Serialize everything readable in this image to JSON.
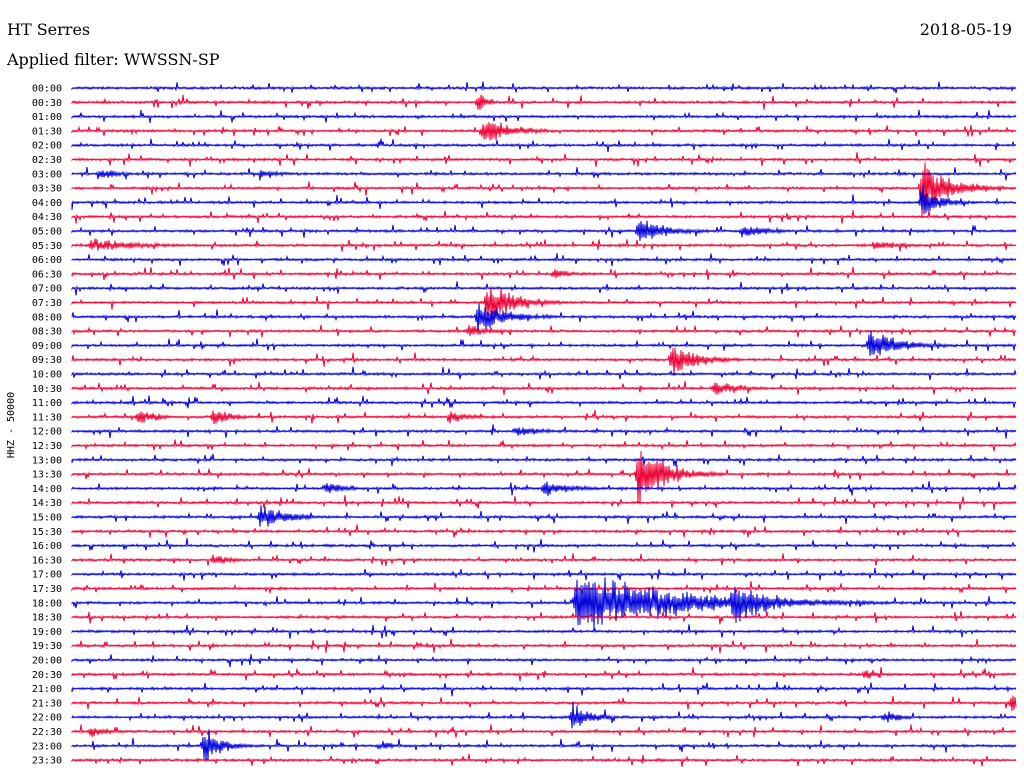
{
  "header": {
    "station": "HT Serres",
    "date": "2018-05-19",
    "filter": "Applied filter: WWSSN-SP"
  },
  "chart_data": {
    "type": "line",
    "ylabel": "HHZ - 50000",
    "tick_labels": [
      "00:00",
      "00:30",
      "01:00",
      "01:30",
      "02:00",
      "02:30",
      "03:00",
      "03:30",
      "04:00",
      "04:30",
      "05:00",
      "05:30",
      "06:00",
      "06:30",
      "07:00",
      "07:30",
      "08:00",
      "08:30",
      "09:00",
      "09:30",
      "10:00",
      "10:30",
      "11:00",
      "11:30",
      "12:00",
      "12:30",
      "13:00",
      "13:30",
      "14:00",
      "14:30",
      "15:00",
      "15:30",
      "16:00",
      "16:30",
      "17:00",
      "17:30",
      "18:00",
      "18:30",
      "19:00",
      "19:30",
      "20:00",
      "20:30",
      "21:00",
      "21:30",
      "22:00",
      "22:30",
      "23:00",
      "23:30"
    ],
    "colors": {
      "even": "#0000dd",
      "odd": "#ee0033"
    },
    "events": [
      {
        "row": 1,
        "t": 0.43,
        "amp": 0.9,
        "dur": 0.01
      },
      {
        "row": 3,
        "t": 0.435,
        "amp": 1.2,
        "dur": 0.03
      },
      {
        "row": 6,
        "t": 0.03,
        "amp": 0.5,
        "dur": 0.02
      },
      {
        "row": 6,
        "t": 0.2,
        "amp": 0.4,
        "dur": 0.02
      },
      {
        "row": 7,
        "t": 0.9,
        "amp": 2.5,
        "dur": 0.03
      },
      {
        "row": 8,
        "t": 0.9,
        "amp": 1.4,
        "dur": 0.02
      },
      {
        "row": 10,
        "t": 0.6,
        "amp": 1.2,
        "dur": 0.03
      },
      {
        "row": 10,
        "t": 0.71,
        "amp": 0.6,
        "dur": 0.03
      },
      {
        "row": 11,
        "t": 0.02,
        "amp": 0.6,
        "dur": 0.05
      },
      {
        "row": 11,
        "t": 0.85,
        "amp": 0.4,
        "dur": 0.03
      },
      {
        "row": 13,
        "t": 0.51,
        "amp": 0.5,
        "dur": 0.02
      },
      {
        "row": 15,
        "t": 0.44,
        "amp": 1.8,
        "dur": 0.03
      },
      {
        "row": 16,
        "t": 0.43,
        "amp": 1.5,
        "dur": 0.03
      },
      {
        "row": 17,
        "t": 0.42,
        "amp": 0.6,
        "dur": 0.02
      },
      {
        "row": 18,
        "t": 0.845,
        "amp": 1.4,
        "dur": 0.03
      },
      {
        "row": 19,
        "t": 0.635,
        "amp": 1.3,
        "dur": 0.03
      },
      {
        "row": 21,
        "t": 0.68,
        "amp": 0.6,
        "dur": 0.03
      },
      {
        "row": 23,
        "t": 0.07,
        "amp": 0.7,
        "dur": 0.02
      },
      {
        "row": 23,
        "t": 0.15,
        "amp": 0.8,
        "dur": 0.02
      },
      {
        "row": 23,
        "t": 0.4,
        "amp": 0.6,
        "dur": 0.02
      },
      {
        "row": 24,
        "t": 0.47,
        "amp": 0.5,
        "dur": 0.03
      },
      {
        "row": 27,
        "t": 0.6,
        "amp": 2.6,
        "dur": 0.03
      },
      {
        "row": 28,
        "t": 0.27,
        "amp": 0.6,
        "dur": 0.02
      },
      {
        "row": 28,
        "t": 0.5,
        "amp": 0.7,
        "dur": 0.03
      },
      {
        "row": 30,
        "t": 0.2,
        "amp": 1.1,
        "dur": 0.03
      },
      {
        "row": 33,
        "t": 0.15,
        "amp": 0.5,
        "dur": 0.02
      },
      {
        "row": 36,
        "t": 0.535,
        "amp": 2.6,
        "dur": 0.11
      },
      {
        "row": 36,
        "t": 0.7,
        "amp": 1.9,
        "dur": 0.04
      },
      {
        "row": 41,
        "t": 0.84,
        "amp": 0.5,
        "dur": 0.01
      },
      {
        "row": 43,
        "t": 0.995,
        "amp": 0.8,
        "dur": 0.02
      },
      {
        "row": 44,
        "t": 0.53,
        "amp": 1.2,
        "dur": 0.02
      },
      {
        "row": 44,
        "t": 0.86,
        "amp": 0.5,
        "dur": 0.02
      },
      {
        "row": 45,
        "t": 0.02,
        "amp": 0.5,
        "dur": 0.02
      },
      {
        "row": 46,
        "t": 0.14,
        "amp": 1.6,
        "dur": 0.02
      },
      {
        "row": 46,
        "t": 0.33,
        "amp": 0.5,
        "dur": 0.01
      }
    ]
  }
}
